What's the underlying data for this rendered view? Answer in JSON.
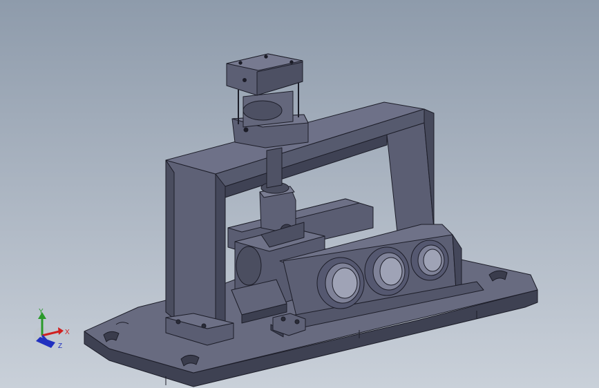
{
  "viewport": {
    "background_top": "#8e9bab",
    "background_bottom": "#c9d0d9",
    "model_color": "#5c5f75",
    "edge_color": "#1c1d28"
  },
  "triad": {
    "x_label": "X",
    "y_label": "Y",
    "z_label": "Z",
    "x_color": "#d02020",
    "y_color": "#2a9a2a",
    "z_color": "#2030c0"
  }
}
